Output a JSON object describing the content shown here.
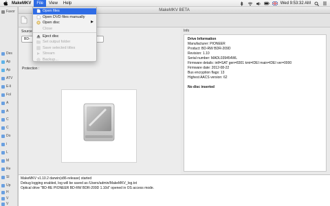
{
  "menubar": {
    "app_name": "MakeMKV",
    "items": [
      {
        "label": "File"
      },
      {
        "label": "View"
      },
      {
        "label": "Help"
      }
    ],
    "clock": "Wed 9:53:32 AM"
  },
  "window": {
    "title": "MakeMKV BETA"
  },
  "file_menu": {
    "items": [
      {
        "label": "Open files",
        "state": "highlighted"
      },
      {
        "label": "Open DVD files manually",
        "state": "enabled"
      },
      {
        "label": "Open disc",
        "state": "enabled",
        "submenu": true
      },
      {
        "label": "Close",
        "state": "disabled"
      },
      {
        "label": "Eject disc",
        "state": "enabled"
      },
      {
        "label": "Set output folder",
        "state": "disabled"
      },
      {
        "label": "Save selected titles",
        "state": "disabled"
      },
      {
        "label": "Stream",
        "state": "disabled"
      },
      {
        "label": "Backup...",
        "state": "disabled"
      }
    ]
  },
  "source_panel": {
    "source_label": "Source",
    "source_value": "BD-",
    "protection_label": "Protection :"
  },
  "info_panel": {
    "header": "Info",
    "lines": [
      {
        "text": "Drive Information",
        "bold": true
      },
      {
        "text": "Manufacturer: PIONEER"
      },
      {
        "text": "Product: BD-RW BDR-209D"
      },
      {
        "text": "Revision: 1.10"
      },
      {
        "text": "Serial number: MADL039454WL"
      },
      {
        "text": "Firmware details: intf=SAT gen=8301 kmi=IDEI main=IDEI ver=0000"
      },
      {
        "text": "Firmware date: 2012-08-22"
      },
      {
        "text": "Bus encryption flags: 13"
      },
      {
        "text": "Highest AACS version: 62"
      },
      {
        "text": ""
      },
      {
        "text": "No disc inserted",
        "bold": true
      }
    ]
  },
  "log": {
    "lines": [
      "MakeMKV v1.10.2 darwin(x86-release) started",
      "Debug logging enabled, log will be saved as /Users/admin/MakeMKV_log.txt",
      "Optical drive \"BD-RE PIONEER BD-RW BDR-209D 1.10d\" opened in OS access mode."
    ]
  },
  "finder_sidebar": {
    "items": [
      "Favor",
      "Des",
      "Ap",
      "Ap",
      "ATV",
      "E-li",
      "Fol",
      "A",
      "A",
      "C",
      "C",
      "Do",
      "i",
      "L",
      "M",
      "Re",
      "Sl",
      "Up",
      "H",
      "V",
      "V"
    ]
  },
  "colors": {
    "highlight": "#2f6ce5",
    "menubar": "#eeeeee"
  }
}
